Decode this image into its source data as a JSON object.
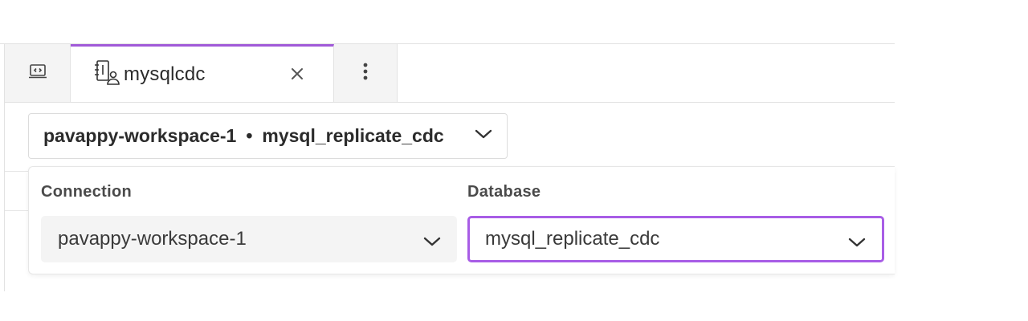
{
  "tabs": {
    "sql_tab_icon": "code-editor-icon",
    "active": {
      "icon": "notebook-user-icon",
      "title": "mysqlcdc",
      "close_icon": "close-icon"
    },
    "more_icon": "more-vertical-icon"
  },
  "context": {
    "workspace": "pavappy-workspace-1",
    "separator": "•",
    "database": "mysql_replicate_cdc",
    "chevron_icon": "chevron-down-icon"
  },
  "panel": {
    "connection_label": "Connection",
    "connection_value": "pavappy-workspace-1",
    "database_label": "Database",
    "database_value": "mysql_replicate_cdc"
  },
  "colors": {
    "accent": "#a05ad8",
    "focus_border": "#a85de6",
    "field_bg": "#f4f4f4"
  }
}
